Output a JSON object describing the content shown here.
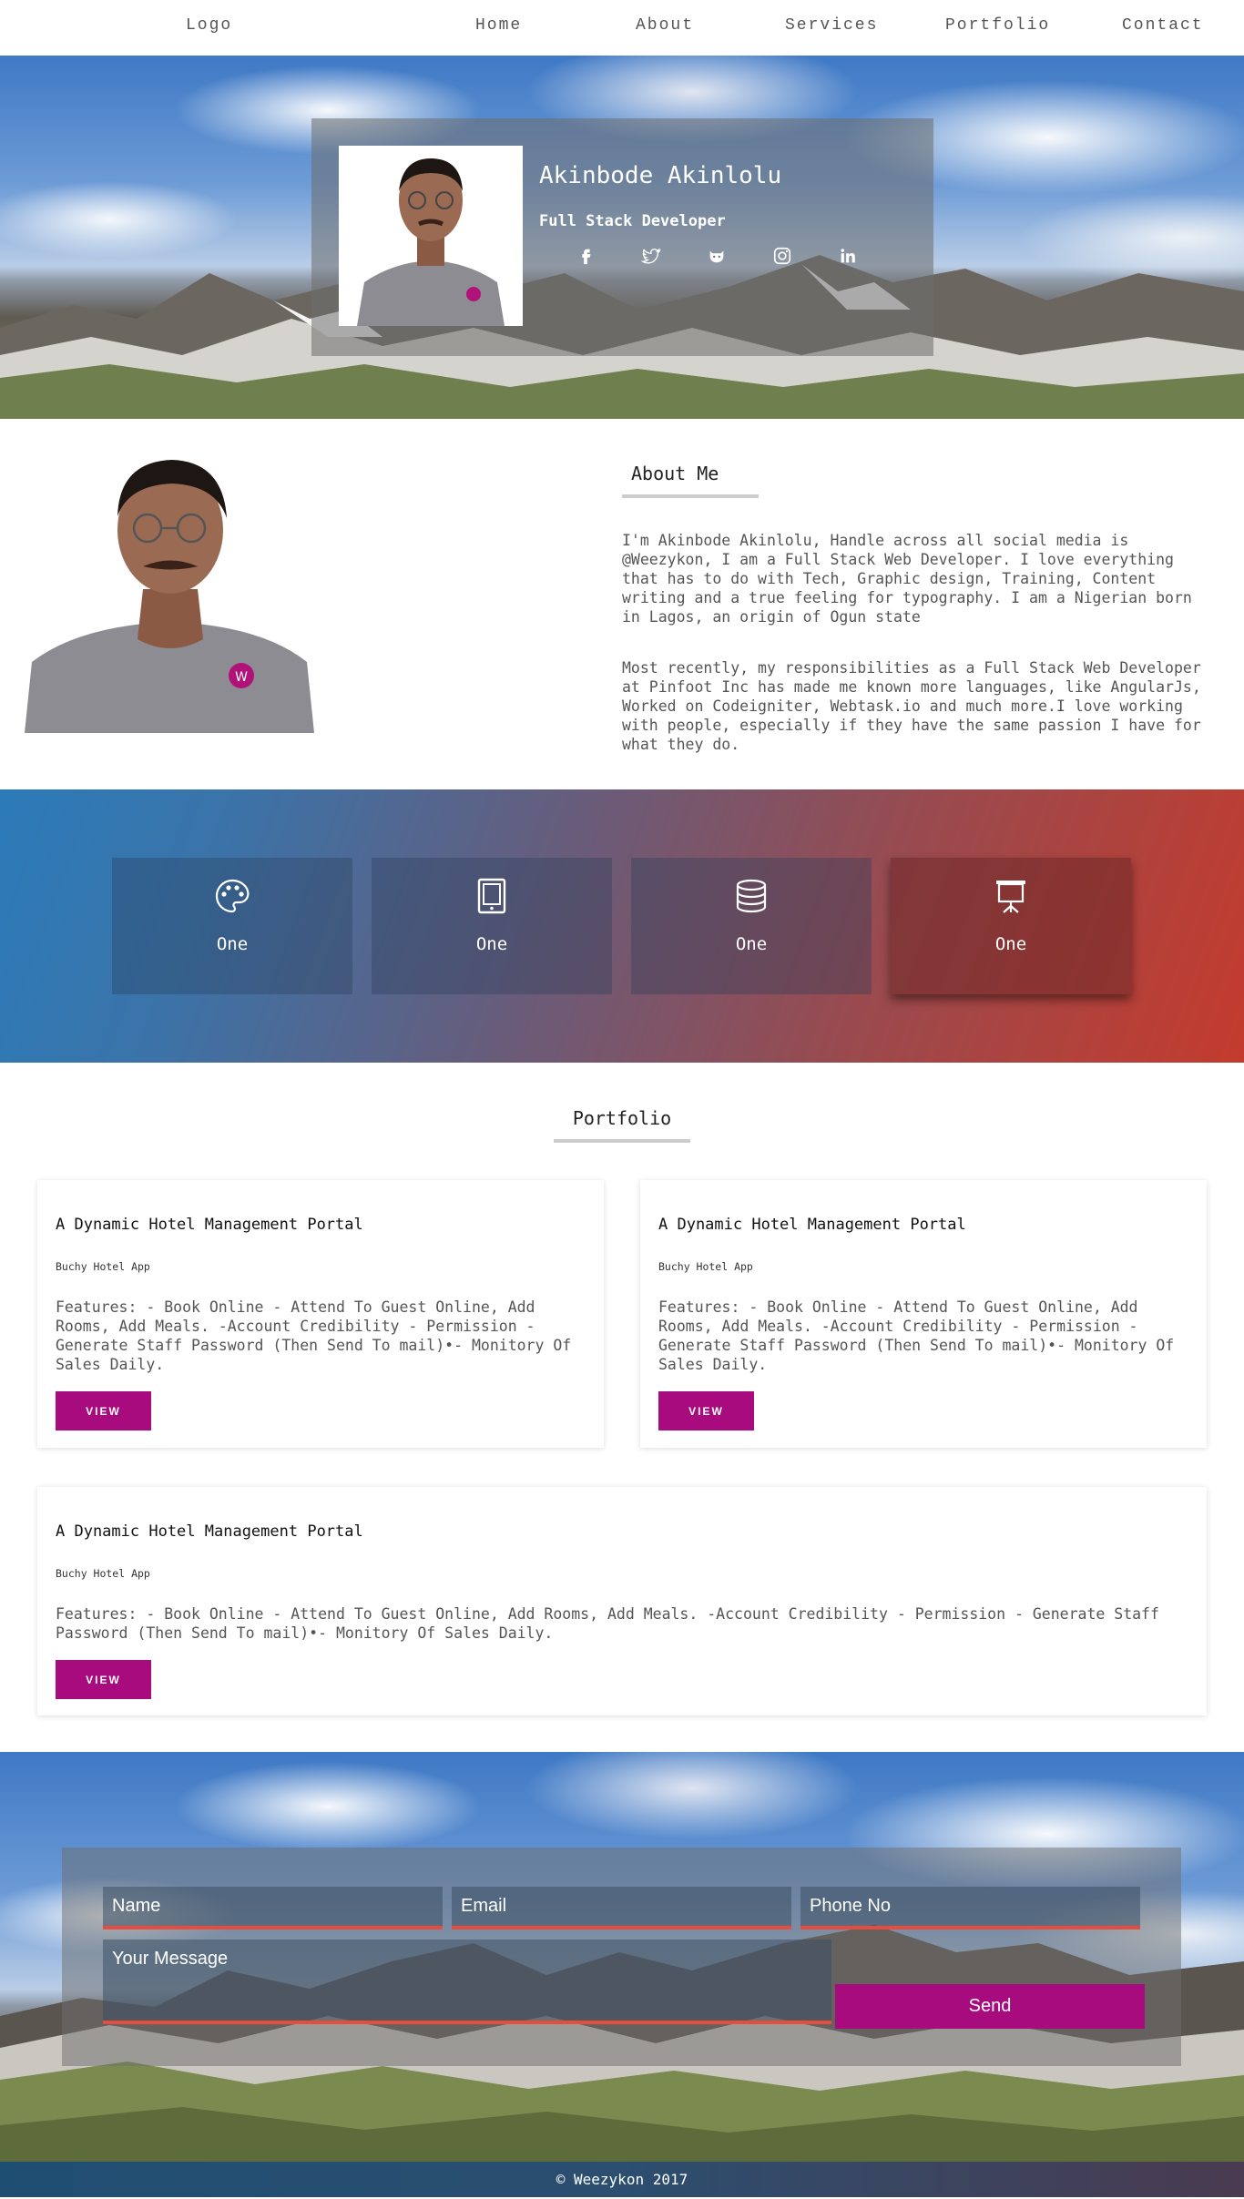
{
  "nav": {
    "logo": "Logo",
    "links": [
      "Home",
      "About",
      "Services",
      "Portfolio",
      "Contact"
    ]
  },
  "hero": {
    "name": "Akinbode Akinlolu",
    "role": "Full Stack Developer",
    "social_icons": [
      "facebook-icon",
      "twitter-icon",
      "github-icon",
      "instagram-icon",
      "linkedin-icon"
    ]
  },
  "about": {
    "title": "About Me",
    "paragraphs": [
      "I'm Akinbode Akinlolu, Handle across all social media is @Weezykon, I am a Full Stack Web Developer. I love everything that has to do with Tech, Graphic design, Training, Content writing and a true feeling for typography. I am a Nigerian born in Lagos, an origin of Ogun state",
      "Most recently, my responsibilities as a Full Stack Web Developer at Pinfoot Inc has made me known more languages, like AngularJs, Worked on Codeigniter, Webtask.io and much more.I love working with people, especially if they have the same passion I have for what they do."
    ]
  },
  "services": {
    "items": [
      {
        "icon": "palette-icon",
        "label": "One"
      },
      {
        "icon": "tablet-icon",
        "label": "One"
      },
      {
        "icon": "database-icon",
        "label": "One"
      },
      {
        "icon": "presentation-icon",
        "label": "One"
      }
    ]
  },
  "portfolio": {
    "title": "Portfolio",
    "cards": [
      {
        "title": "A Dynamic Hotel Management Portal",
        "subtitle": "Buchy Hotel App",
        "description": "Features: - Book Online - Attend To Guest Online, Add Rooms, Add Meals. -Account Credibility - Permission - Generate Staff Password (Then Send To mail)•- Monitory Of Sales Daily.",
        "button": "VIEW"
      },
      {
        "title": "A Dynamic Hotel Management Portal",
        "subtitle": "Buchy Hotel App",
        "description": "Features: - Book Online - Attend To Guest Online, Add Rooms, Add Meals. -Account Credibility - Permission - Generate Staff Password (Then Send To mail)•- Monitory Of Sales Daily.",
        "button": "VIEW"
      },
      {
        "title": "A Dynamic Hotel Management Portal",
        "subtitle": "Buchy Hotel App",
        "description": "Features: - Book Online - Attend To Guest Online, Add Rooms, Add Meals. -Account Credibility - Permission - Generate Staff Password (Then Send To mail)•- Monitory Of Sales Daily.",
        "button": "VIEW"
      }
    ]
  },
  "contact": {
    "name_placeholder": "Name",
    "email_placeholder": "Email",
    "phone_placeholder": "Phone No",
    "message_placeholder": "Your Message",
    "send_label": "Send"
  },
  "footer": {
    "text": "© Weezykon 2017"
  },
  "colors": {
    "accent": "#a80b7e",
    "input_underline": "#e74c3c",
    "services_gradient": [
      "#2b7bb9",
      "#c43b2d"
    ]
  }
}
